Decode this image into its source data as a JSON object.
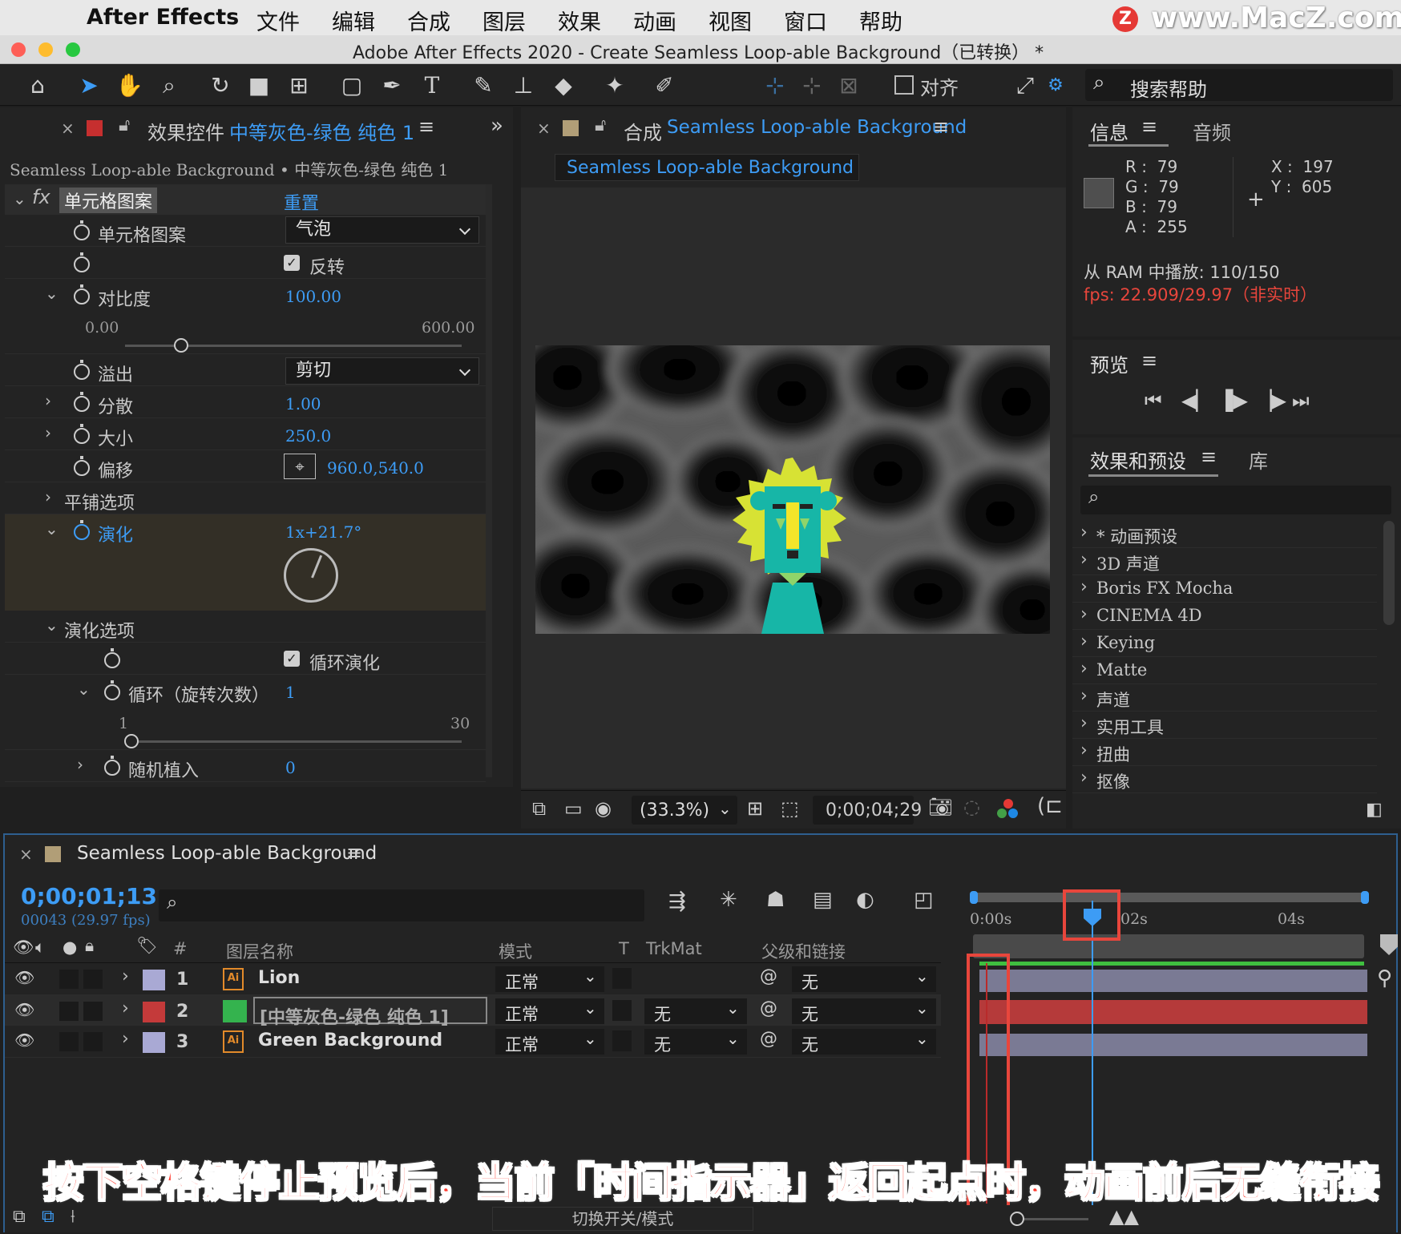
{
  "menubar": {
    "app_name": "After Effects",
    "items": [
      "文件",
      "编辑",
      "合成",
      "图层",
      "效果",
      "动画",
      "视图",
      "窗口",
      "帮助"
    ],
    "watermark": "www.MacZ.com",
    "watermark_logo": "Z"
  },
  "window": {
    "title": "Adobe After Effects 2020 - Create Seamless Loop-able Background（已转换） *"
  },
  "toolbar": {
    "align_label": "对齐",
    "search_help": "搜索帮助"
  },
  "effects_panel": {
    "tab_prefix": "效果控件",
    "tab_layer": "中等灰色-绿色 纯色 1",
    "breadcrumb": "Seamless Loop-able Background • 中等灰色-绿色 纯色 1",
    "effect_name": "单元格图案",
    "reset": "重置",
    "props": {
      "pattern_label": "单元格图案",
      "pattern_value": "气泡",
      "invert_label": "反转",
      "contrast_label": "对比度",
      "contrast_value": "100.00",
      "contrast_min": "0.00",
      "contrast_max": "600.00",
      "contrast_fraction": 0.167,
      "overflow_label": "溢出",
      "overflow_value": "剪切",
      "disperse_label": "分散",
      "disperse_value": "1.00",
      "size_label": "大小",
      "size_value": "250.0",
      "offset_label": "偏移",
      "offset_value": "960.0,540.0",
      "tiling_label": "平铺选项",
      "evolution_label": "演化",
      "evolution_value": "1x+21.7°",
      "evo_options_label": "演化选项",
      "cycle_evo_label": "循环演化",
      "cycle_label": "循环（旋转次数）",
      "cycle_value": "1",
      "cycle_min": "1",
      "cycle_max": "30",
      "cycle_fraction": 0.0,
      "seed_label": "随机植入",
      "seed_value": "0"
    }
  },
  "comp_panel": {
    "tab_prefix": "合成",
    "tab_name": "Seamless Loop-able Background",
    "subtab": "Seamless Loop-able Background",
    "zoom": "(33.3%)",
    "timecode": "0;00;04;29"
  },
  "info_panel": {
    "tab_info": "信息",
    "tab_audio": "音频",
    "r": "79",
    "g": "79",
    "b": "79",
    "a": "255",
    "x": "197",
    "y": "605",
    "ram": "从 RAM 中播放: 110/150",
    "fps": "fps: 22.909/29.97（非实时）"
  },
  "preview_panel": {
    "title": "预览"
  },
  "effects_presets": {
    "tab": "效果和预设",
    "tab_lib": "库",
    "items": [
      "* 动画预设",
      "3D 声道",
      "Boris FX Mocha",
      "CINEMA 4D",
      "Keying",
      "Matte",
      "声道",
      "实用工具",
      "扭曲",
      "抠像"
    ]
  },
  "timeline": {
    "comp_name": "Seamless Loop-able Background",
    "timecode": "0;00;01;13",
    "frames": "00043 (29.97 fps)",
    "headers": {
      "num": "#",
      "layer_name": "图层名称",
      "mode": "模式",
      "t": "T",
      "trkmat": "TrkMat",
      "parent": "父级和链接"
    },
    "ruler": [
      "0:00s",
      "02s",
      "04s"
    ],
    "layers": [
      {
        "num": "1",
        "name": "Lion",
        "mode": "正常",
        "trkmat": "",
        "parent": "无",
        "color": "#a9a9d4"
      },
      {
        "num": "2",
        "name": "[中等灰色-绿色 纯色 1]",
        "mode": "正常",
        "trkmat": "无",
        "parent": "无",
        "color": "#c43a3a"
      },
      {
        "num": "3",
        "name": "Green Background",
        "mode": "正常",
        "trkmat": "无",
        "parent": "无",
        "color": "#a9a9d4"
      }
    ],
    "footer_toggle": "切换开关/模式"
  },
  "caption": "按下空格键停止预览后，当前「时间指示器」返回起点时，动画前后无缝衔接",
  "colors": {
    "accent_blue": "#3d9cf5",
    "highlight_red": "#e8463c",
    "caption_fill": "#ff3b2f",
    "lion_yellow": "#d7e234",
    "lion_teal": "#17b6a7"
  }
}
